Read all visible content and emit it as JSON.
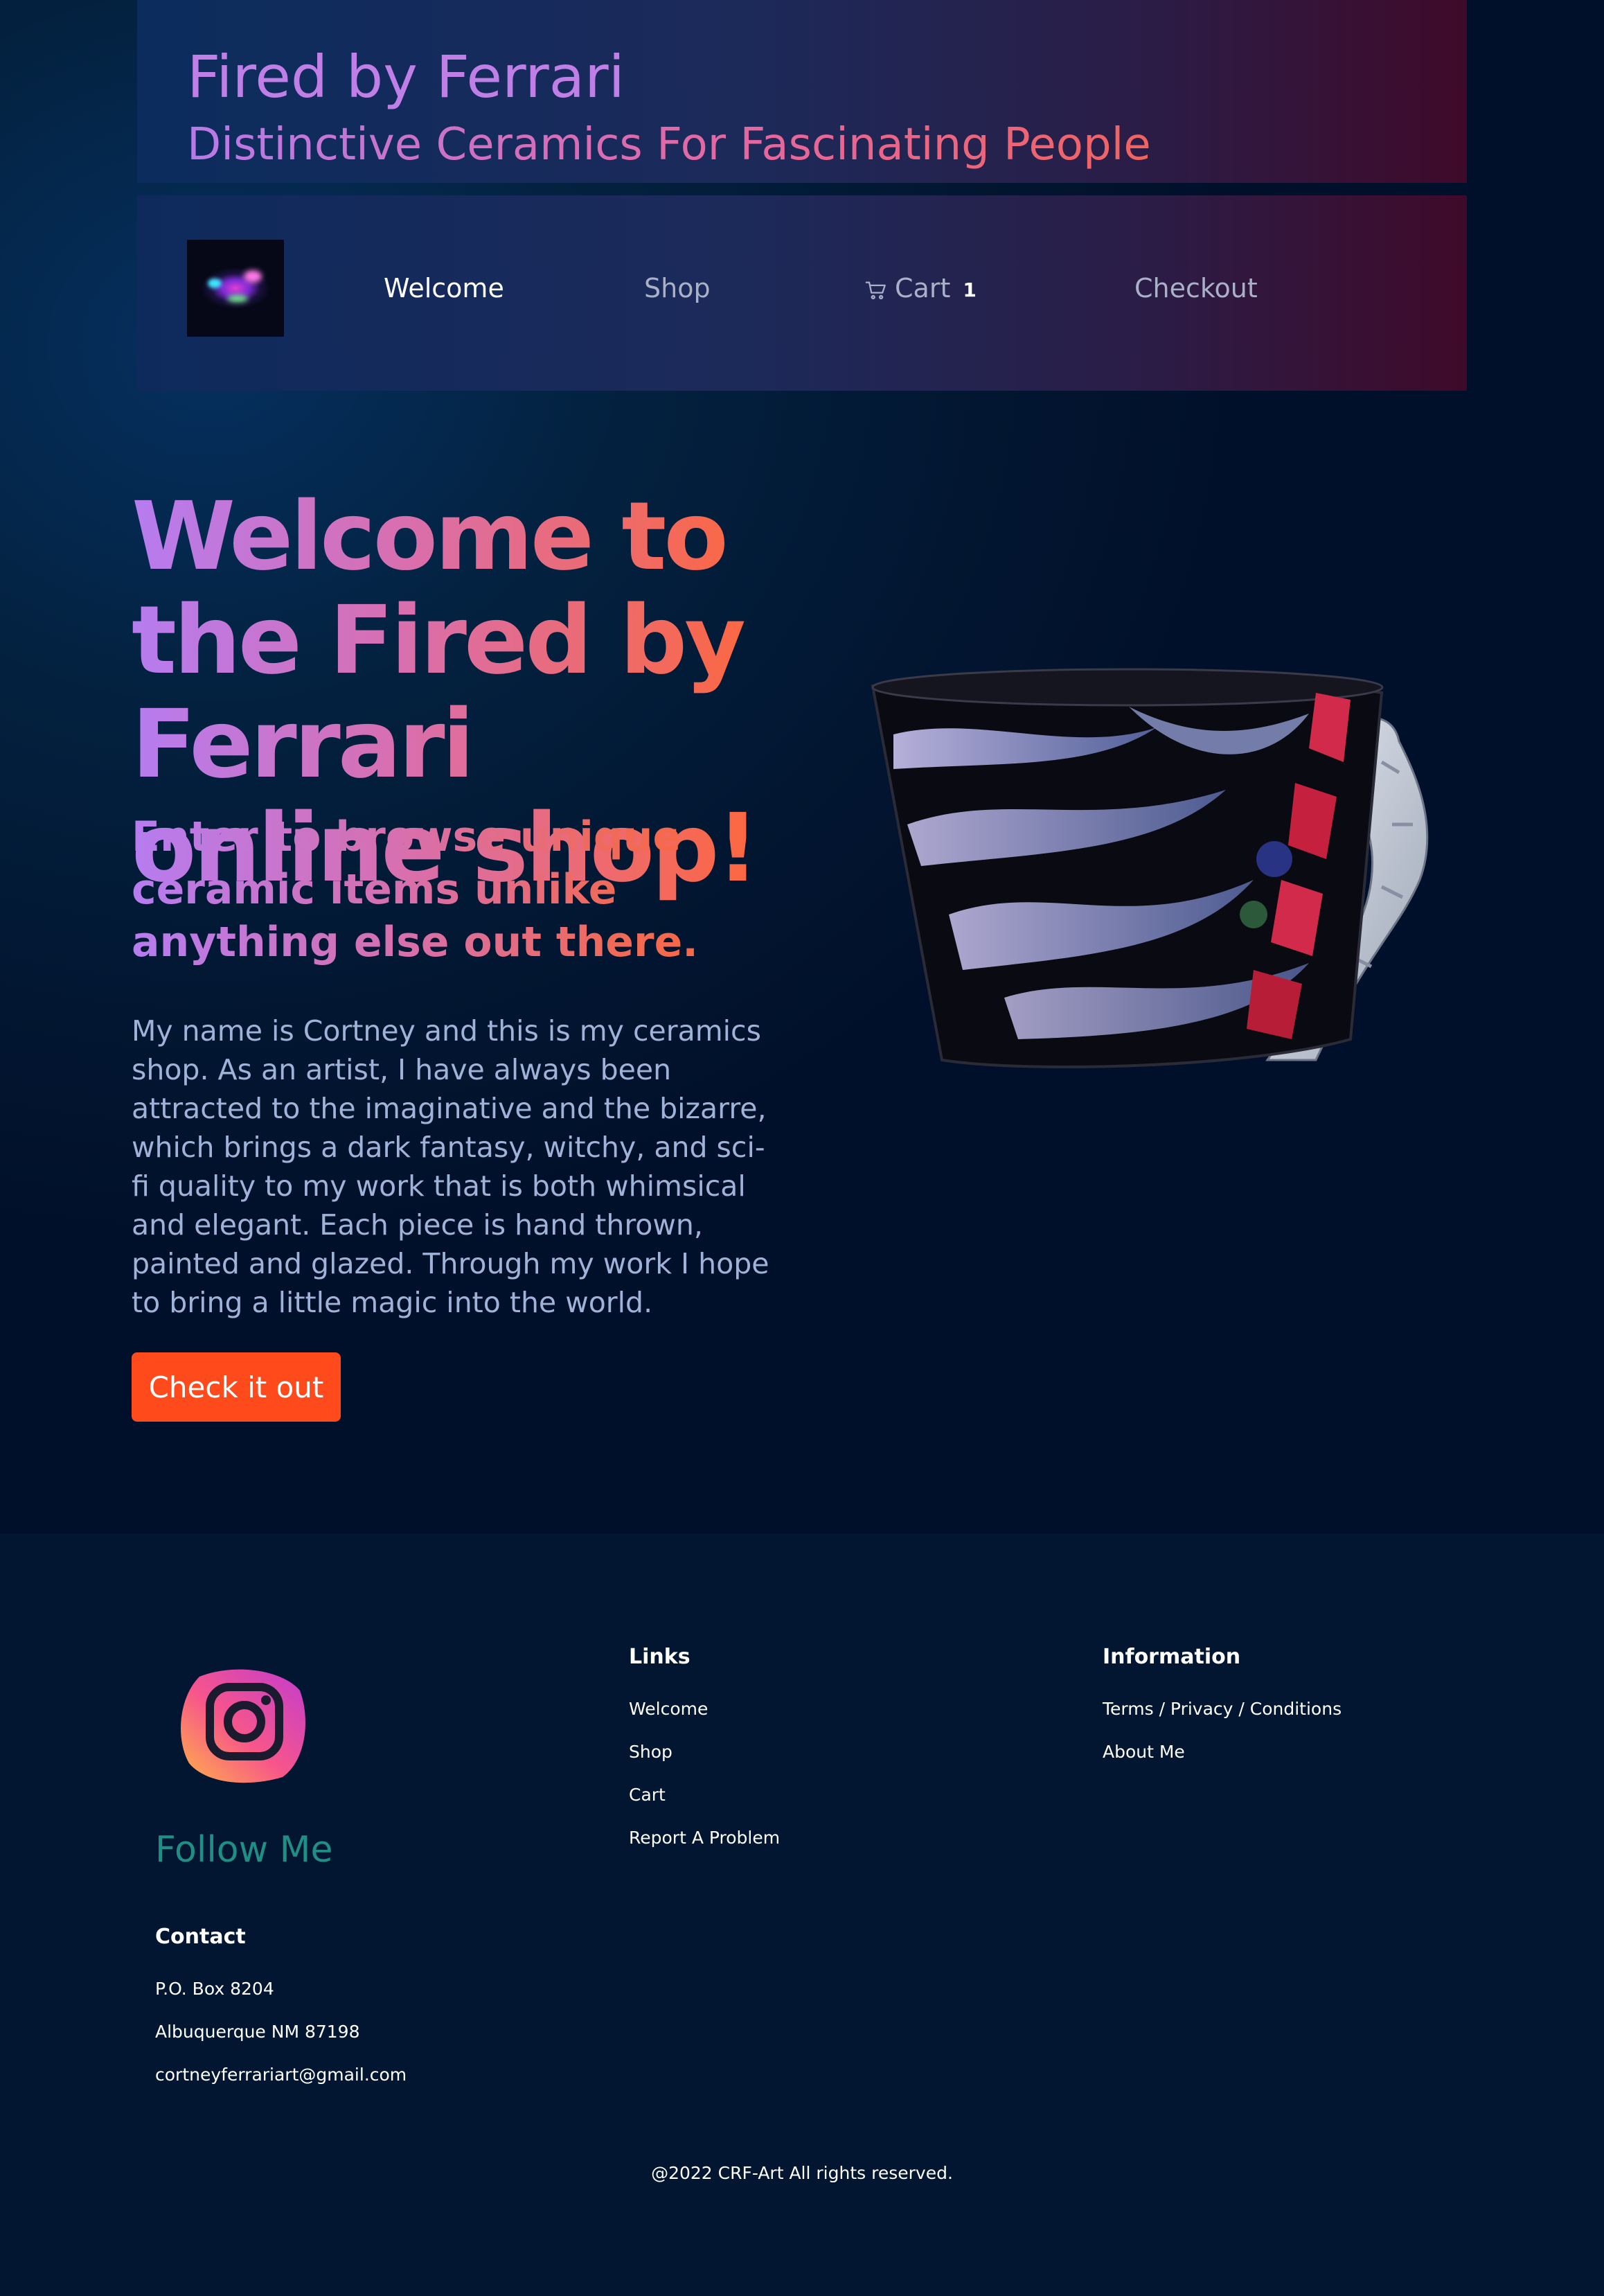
{
  "header": {
    "brand_title": "Fired by Ferrari",
    "tagline": "Distinctive Ceramics For Fascinating People"
  },
  "nav": {
    "items": [
      {
        "label": "Welcome",
        "active": true
      },
      {
        "label": "Shop",
        "active": false
      },
      {
        "label": "Cart",
        "active": false,
        "icon": "cart-icon",
        "count": "1"
      },
      {
        "label": "Checkout",
        "active": false
      }
    ]
  },
  "hero": {
    "heading": "Welcome to the Fired by Ferrari online shop!",
    "subheading": "Enter to browse unique ceramic items unlike anything else out there.",
    "body": "My name is Cortney and this is my ceramics shop. As an artist, I have always been attracted to the imaginative and the bizarre, which brings a dark fantasy, witchy, and sci-fi quality to my work that is both whimsical and elegant. Each piece is hand thrown, painted and glazed. Through my work I hope to bring a little magic into the world.",
    "cta_label": "Check it out",
    "image": "ceramic-mug-image"
  },
  "footer": {
    "social_icon": "instagram-icon",
    "follow_label": "Follow Me",
    "contact": {
      "heading": "Contact",
      "lines": [
        "P.O. Box 8204",
        "Albuquerque NM 87198",
        "cortneyferrariart@gmail.com"
      ]
    },
    "links": {
      "heading": "Links",
      "items": [
        "Welcome",
        "Shop",
        "Cart",
        "Report A Problem"
      ]
    },
    "information": {
      "heading": "Information",
      "items": [
        "Terms / Privacy / Conditions",
        "About Me"
      ]
    },
    "copyright": "@2022 CRF-Art All rights reserved."
  },
  "colors": {
    "background": "#02142b",
    "cta": "#ff4a1c",
    "follow": "#1f8f86",
    "nav_active": "#ffffff",
    "nav_inactive": "#a9b0c8"
  }
}
